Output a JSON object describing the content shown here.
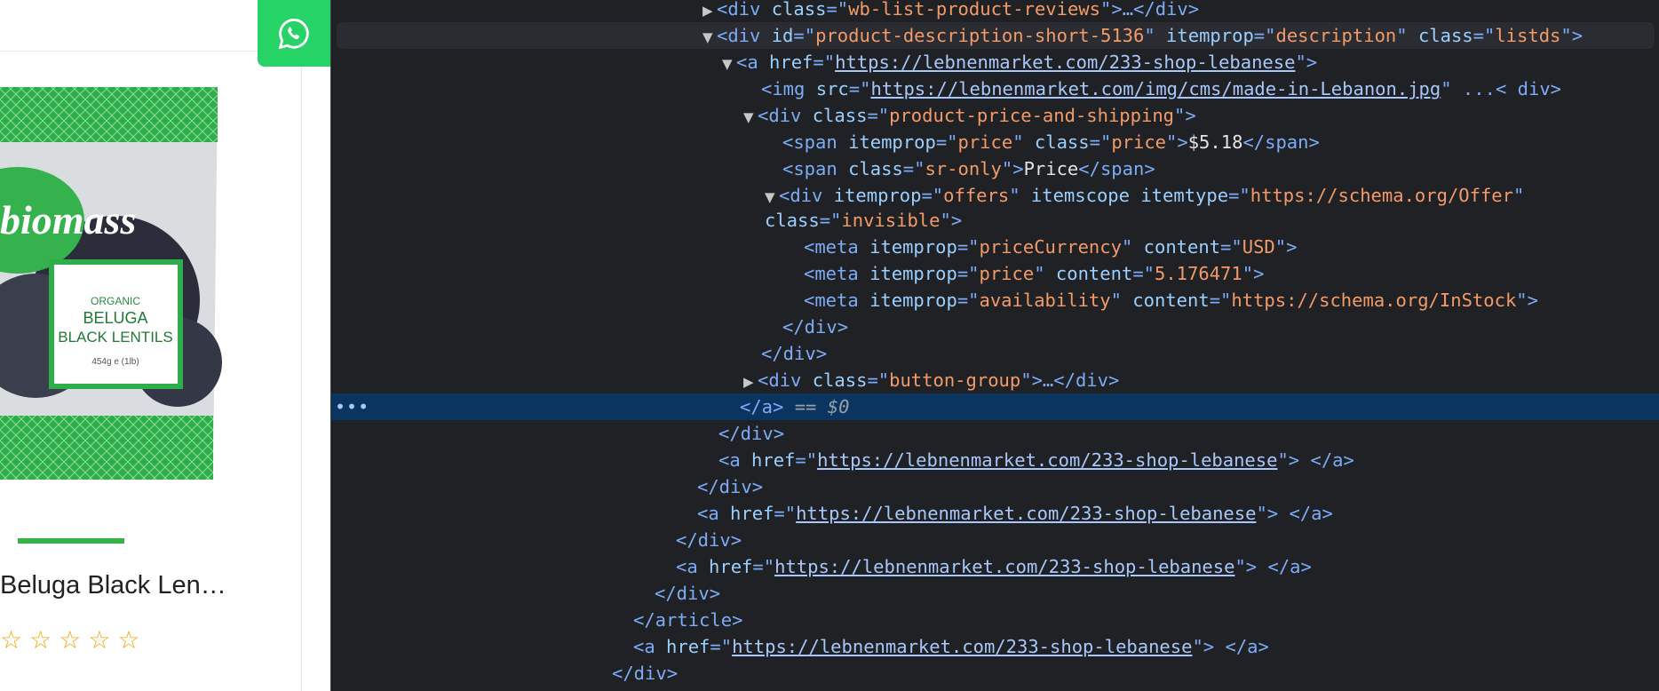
{
  "page": {
    "product_name": "Beluga Black Len…",
    "stars": [
      "☆",
      "☆",
      "☆",
      "☆",
      "☆"
    ],
    "package": {
      "brand": "biomass",
      "label_line1": "ORGANIC",
      "label_line2": "BELUGA",
      "label_line3": "BLACK LENTILS",
      "weight": "454g e (1lb)"
    }
  },
  "colors": {
    "accent_green": "#34b34a",
    "whatsapp": "#25d366",
    "star": "#f0a80c"
  },
  "dom": {
    "l1": {
      "tri": "▶",
      "a1": "class",
      "v1": "wb-list-product-reviews",
      "tail": "…</div>"
    },
    "l2": {
      "tri": "▼",
      "a1": "id",
      "v1": "product-description-short-5136",
      "a2": "itemprop",
      "v2": "description",
      "a3": "class",
      "v3": "listds"
    },
    "l3": {
      "tri": "▼",
      "a1": "href",
      "link": "https://lebnenmarket.com/233-shop-lebanese"
    },
    "l4": {
      "a1": "src",
      "link": "https://lebnenmarket.com/img/cms/made-in-Lebanon.jpg",
      "tail": " ...< div>"
    },
    "l5": {
      "tri": "▼",
      "a1": "class",
      "v1": "product-price-and-shipping"
    },
    "l6": {
      "a1": "itemprop",
      "v1": "price",
      "a2": "class",
      "v2": "price",
      "text": "$5.18"
    },
    "l7": {
      "a1": "class",
      "v1": "sr-only",
      "text": "Price"
    },
    "l8": {
      "tri": "▼",
      "a1": "itemprop",
      "v1": "offers",
      "a2": "itemscope",
      "a3": "itemtype",
      "v3": "https://schema.org/Offer"
    },
    "l9": {
      "a1": "class",
      "v1": "invisible"
    },
    "l10": {
      "a1": "itemprop",
      "v1": "priceCurrency",
      "a2": "content",
      "v2": "USD"
    },
    "l11": {
      "a1": "itemprop",
      "v1": "price",
      "a2": "content",
      "v2": "5.176471"
    },
    "l12": {
      "a1": "itemprop",
      "v1": "availability",
      "a2": "content",
      "v2": "https://schema.org/InStock"
    },
    "l15": {
      "tri": "▶",
      "a1": "class",
      "v1": "button-group",
      "tail": "…</div>"
    },
    "l16": {
      "dots": "•••",
      "eq": "== $0"
    },
    "link": "https://lebnenmarket.com/233-shop-lebanese"
  }
}
